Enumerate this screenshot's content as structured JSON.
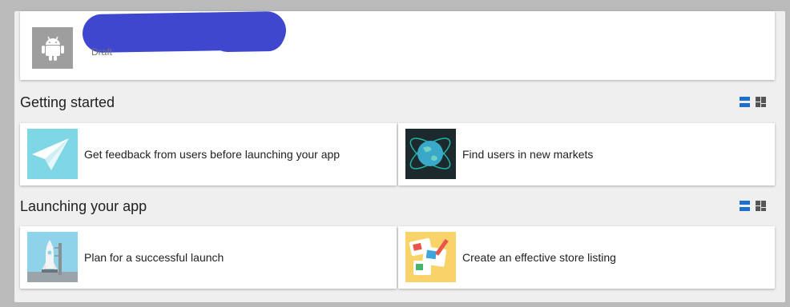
{
  "app": {
    "status": "Draft"
  },
  "sections": [
    {
      "title": "Getting started",
      "cards": [
        {
          "label": "Get feedback from users before launching your app",
          "icon": "paper-plane-icon"
        },
        {
          "label": "Find users in new markets",
          "icon": "globe-icon"
        }
      ]
    },
    {
      "title": "Launching your app",
      "cards": [
        {
          "label": "Plan for a successful launch",
          "icon": "rocket-icon"
        },
        {
          "label": "Create an effective store listing",
          "icon": "store-listing-icon"
        }
      ]
    }
  ],
  "colors": {
    "accent": "#1e6fd0",
    "redaction": "#3f47cf",
    "app_icon_bg": "#9e9e9e"
  }
}
